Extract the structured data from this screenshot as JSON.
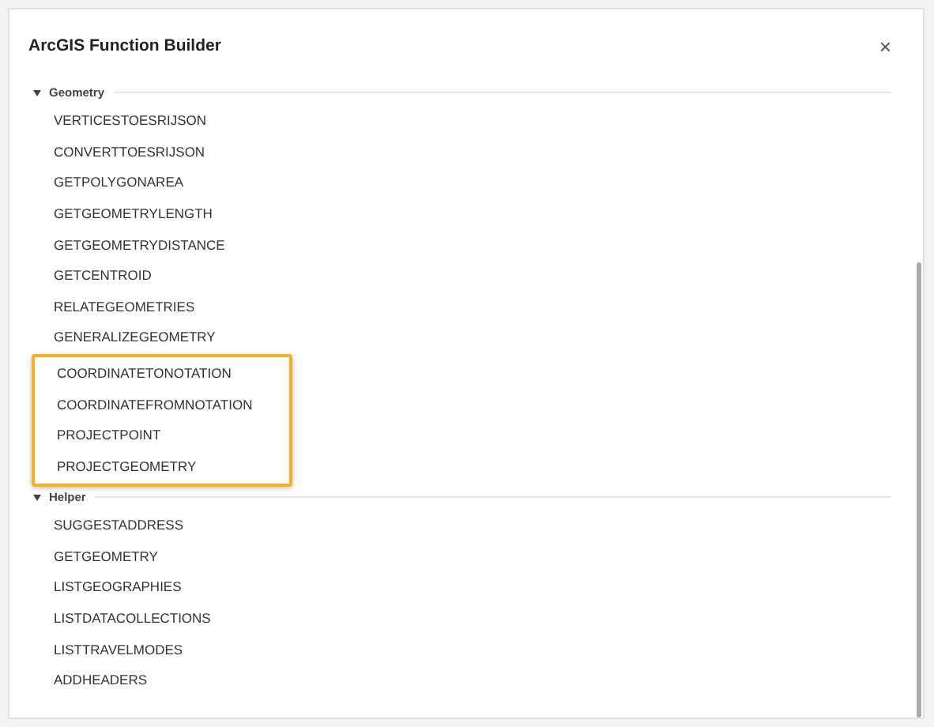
{
  "dialog": {
    "title": "ArcGIS Function Builder",
    "close": "×"
  },
  "categories": [
    {
      "name": "Geometry",
      "expanded": true,
      "items": [
        {
          "label": "VERTICESTOESRIJSON",
          "highlighted": false
        },
        {
          "label": "CONVERTTOESRIJSON",
          "highlighted": false
        },
        {
          "label": "GETPOLYGONAREA",
          "highlighted": false
        },
        {
          "label": "GETGEOMETRYLENGTH",
          "highlighted": false
        },
        {
          "label": "GETGEOMETRYDISTANCE",
          "highlighted": false
        },
        {
          "label": "GETCENTROID",
          "highlighted": false
        },
        {
          "label": "RELATEGEOMETRIES",
          "highlighted": false
        },
        {
          "label": "GENERALIZEGEOMETRY",
          "highlighted": false
        },
        {
          "label": "COORDINATETONOTATION",
          "highlighted": true
        },
        {
          "label": "COORDINATEFROMNOTATION",
          "highlighted": true
        },
        {
          "label": "PROJECTPOINT",
          "highlighted": true
        },
        {
          "label": "PROJECTGEOMETRY",
          "highlighted": true
        }
      ]
    },
    {
      "name": "Helper",
      "expanded": true,
      "items": [
        {
          "label": "SUGGESTADDRESS",
          "highlighted": false
        },
        {
          "label": "GETGEOMETRY",
          "highlighted": false
        },
        {
          "label": "LISTGEOGRAPHIES",
          "highlighted": false
        },
        {
          "label": "LISTDATACOLLECTIONS",
          "highlighted": false
        },
        {
          "label": "LISTTRAVELMODES",
          "highlighted": false
        },
        {
          "label": "ADDHEADERS",
          "highlighted": false
        }
      ]
    }
  ]
}
